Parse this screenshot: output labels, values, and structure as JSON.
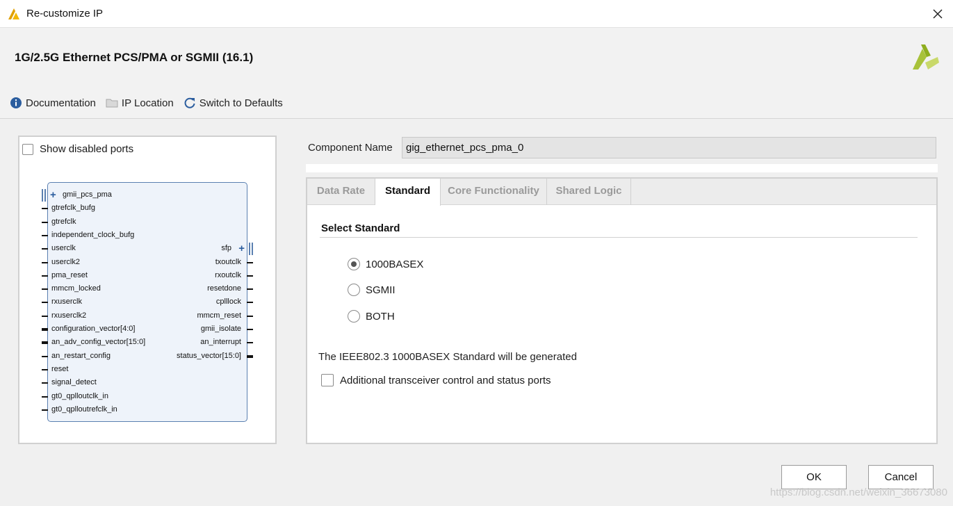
{
  "window": {
    "title": "Re-customize IP"
  },
  "header": {
    "ip_title": "1G/2.5G Ethernet PCS/PMA or SGMII (16.1)",
    "toolbar": {
      "documentation": "Documentation",
      "ip_location": "IP Location",
      "switch_defaults": "Switch to Defaults"
    }
  },
  "left_panel": {
    "show_disabled_ports": "Show disabled ports",
    "show_disabled_checked": false,
    "block": {
      "left_ports": [
        {
          "name": "gmii_pcs_pma",
          "type": "bus-interface"
        },
        {
          "name": "gtrefclk_bufg",
          "type": "wire"
        },
        {
          "name": "gtrefclk",
          "type": "wire"
        },
        {
          "name": "independent_clock_bufg",
          "type": "wire"
        },
        {
          "name": "userclk",
          "type": "wire"
        },
        {
          "name": "userclk2",
          "type": "wire"
        },
        {
          "name": "pma_reset",
          "type": "wire"
        },
        {
          "name": "mmcm_locked",
          "type": "wire"
        },
        {
          "name": "rxuserclk",
          "type": "wire"
        },
        {
          "name": "rxuserclk2",
          "type": "wire"
        },
        {
          "name": "configuration_vector[4:0]",
          "type": "bus"
        },
        {
          "name": "an_adv_config_vector[15:0]",
          "type": "bus"
        },
        {
          "name": "an_restart_config",
          "type": "wire"
        },
        {
          "name": "reset",
          "type": "wire"
        },
        {
          "name": "signal_detect",
          "type": "wire"
        },
        {
          "name": "gt0_qplloutclk_in",
          "type": "wire"
        },
        {
          "name": "gt0_qplloutrefclk_in",
          "type": "wire"
        }
      ],
      "right_ports": [
        {
          "name": "sfp",
          "type": "bus-interface"
        },
        {
          "name": "txoutclk",
          "type": "wire"
        },
        {
          "name": "rxoutclk",
          "type": "wire"
        },
        {
          "name": "resetdone",
          "type": "wire"
        },
        {
          "name": "cplllock",
          "type": "wire"
        },
        {
          "name": "mmcm_reset",
          "type": "wire"
        },
        {
          "name": "gmii_isolate",
          "type": "wire"
        },
        {
          "name": "an_interrupt",
          "type": "wire"
        },
        {
          "name": "status_vector[15:0]",
          "type": "bus"
        }
      ]
    }
  },
  "component": {
    "label": "Component Name",
    "value": "gig_ethernet_pcs_pma_0"
  },
  "tabs": [
    {
      "label": "Data Rate",
      "active": false
    },
    {
      "label": "Standard",
      "active": true
    },
    {
      "label": "Core Functionality",
      "active": false
    },
    {
      "label": "Shared Logic",
      "active": false
    }
  ],
  "standard": {
    "section_title": "Select Standard",
    "options": [
      {
        "label": "1000BASEX",
        "selected": true
      },
      {
        "label": "SGMII",
        "selected": false
      },
      {
        "label": "BOTH",
        "selected": false
      }
    ],
    "info": "The IEEE802.3 1000BASEX Standard will be generated",
    "additional_ports_label": "Additional transceiver control and status ports",
    "additional_ports_checked": false
  },
  "buttons": {
    "ok": "OK",
    "cancel": "Cancel"
  },
  "watermark": "https://blog.csdn.net/weixin_36673080",
  "colors": {
    "accent_blue": "#2b5d9e",
    "block_fill": "#eef3fa",
    "logo_green": "#9fba2a"
  }
}
